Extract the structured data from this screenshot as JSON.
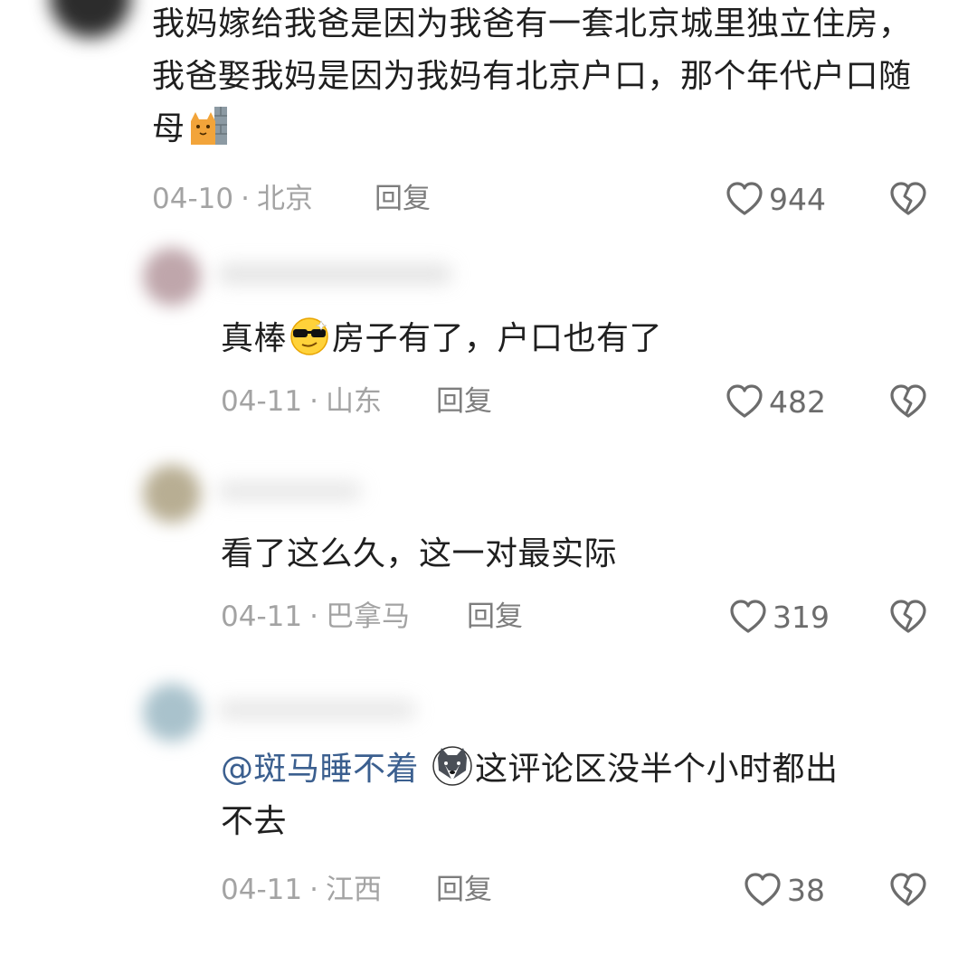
{
  "comments": [
    {
      "text": "我妈嫁给我爸是因为我爸有一套北京城里独立住房，我爸娶我妈是因为我妈有北京户口，那个年代户口随母",
      "emoji": "cat-wall-emoji",
      "date": "04-10",
      "location": "北京",
      "reply_label": "回复",
      "likes": "944"
    },
    {
      "text_before": "真棒",
      "emoji": "sunglasses-face-emoji",
      "text_after": "房子有了，户口也有了",
      "date": "04-11",
      "location": "山东",
      "reply_label": "回复",
      "likes": "482"
    },
    {
      "text": "看了这么久，这一对最实际",
      "date": "04-11",
      "location": "巴拿马",
      "reply_label": "回复",
      "likes": "319"
    },
    {
      "mention": "@斑马睡不着",
      "emoji": "wolf-face-emoji",
      "text_line1": "这评论区没半个小时都出",
      "text_line2": "不去",
      "date": "04-11",
      "location": "江西",
      "reply_label": "回复",
      "likes": "38"
    }
  ],
  "meta_separator": "·",
  "colors": {
    "text": "#1f1f1f",
    "meta": "#a3a3a3",
    "mention": "#3b5f8f",
    "icon": "#6c6c6c"
  }
}
